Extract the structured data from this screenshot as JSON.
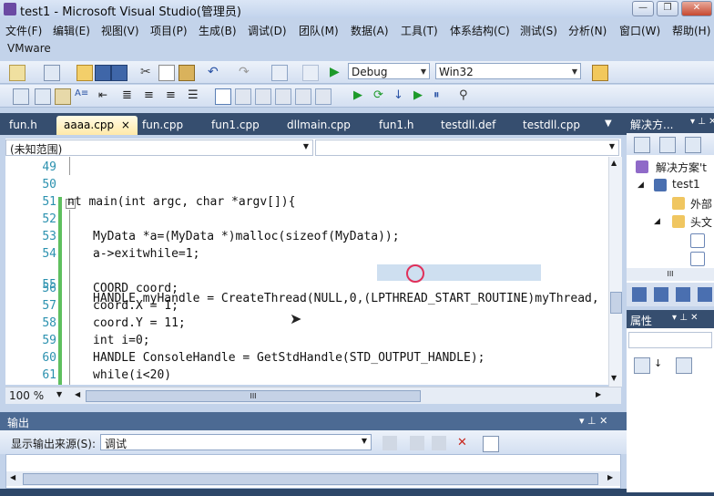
{
  "window": {
    "title": "test1 - Microsoft Visual Studio(管理员)",
    "minimize": "—",
    "restore": "❐",
    "close": "✕"
  },
  "menus": [
    "文件(F)",
    "编辑(E)",
    "视图(V)",
    "项目(P)",
    "生成(B)",
    "调试(D)",
    "团队(M)",
    "数据(A)",
    "工具(T)",
    "体系结构(C)",
    "测试(S)",
    "分析(N)",
    "窗口(W)",
    "帮助(H)"
  ],
  "extra_menu": "VMware",
  "toolbar": {
    "config": "Debug",
    "platform": "Win32"
  },
  "tabs": [
    {
      "label": "fun.h",
      "active": false
    },
    {
      "label": "aaaa.cpp",
      "active": true,
      "close": "×"
    },
    {
      "label": "fun.cpp",
      "active": false
    },
    {
      "label": "fun1.cpp",
      "active": false
    },
    {
      "label": "dllmain.cpp",
      "active": false
    },
    {
      "label": "fun1.h",
      "active": false
    },
    {
      "label": "testdll.def",
      "active": false
    },
    {
      "label": "testdll.cpp",
      "active": false
    }
  ],
  "editor": {
    "scope": "(未知范围)",
    "zoom": "100 %",
    "lines": [
      {
        "n": "49",
        "code": ""
      },
      {
        "n": "50",
        "code": ""
      },
      {
        "n": "51",
        "code": "nt main(int argc, char *argv[]){"
      },
      {
        "n": "52",
        "code": ""
      },
      {
        "n": "53",
        "code": "MyData *a=(MyData *)malloc(sizeof(MyData));"
      },
      {
        "n": "54",
        "code": "a->exitwhile=1;"
      },
      {
        "n": "55",
        "code": "HANDLE myHandle = CreateThread(NULL,0,(LPTHREAD_START_ROUTINE)myThread,"
      },
      {
        "n": "56",
        "code": "COORD coord;"
      },
      {
        "n": "57",
        "code": "coord.X = 1;"
      },
      {
        "n": "58",
        "code": "coord.Y = 11;"
      },
      {
        "n": "59",
        "code": "int i=0;"
      },
      {
        "n": "60",
        "code": "HANDLE ConsoleHandle = GetStdHandle(STD_OUTPUT_HANDLE);"
      },
      {
        "n": "61",
        "code": "while(i<20)"
      }
    ],
    "hscroll_grip": "III"
  },
  "output": {
    "title": "输出",
    "source_label": "显示输出来源(S):",
    "source_value": "调试",
    "pin": "▾ ⊥ ✕"
  },
  "solution": {
    "title": "解决方...",
    "pin": "▾ ⊥ ✕",
    "items": [
      "解决方案't",
      "test1",
      "外部",
      "头文"
    ],
    "grip": "III"
  },
  "properties": {
    "title": "属性",
    "pin": "▾ ⊥ ✕"
  }
}
